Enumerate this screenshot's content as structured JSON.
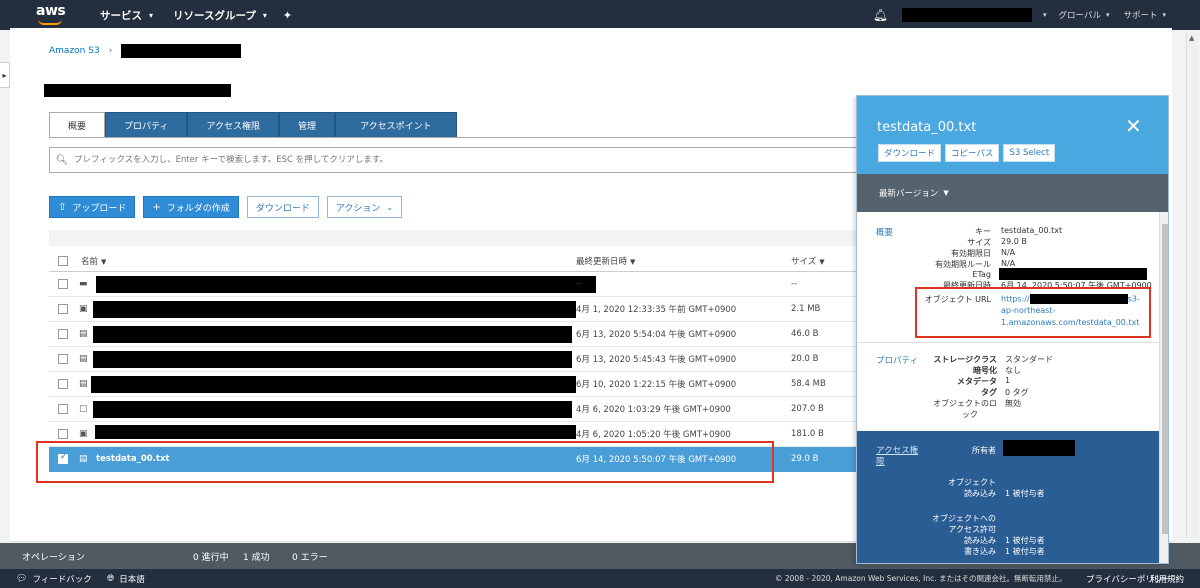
{
  "topnav": {
    "logo": "aws",
    "services": "サービス",
    "resource_groups": "リソースグループ",
    "global": "グローバル",
    "support": "サポート"
  },
  "breadcrumb": {
    "root": "Amazon S3"
  },
  "tabs": [
    {
      "label": "概要"
    },
    {
      "label": "プロパティ"
    },
    {
      "label": "アクセス権限"
    },
    {
      "label": "管理"
    },
    {
      "label": "アクセスポイント"
    }
  ],
  "search": {
    "placeholder": "プレフィックスを入力し、Enter キーで検索します。ESC を押してクリアします。"
  },
  "toolbar": {
    "upload": "アップロード",
    "create_folder": "フォルダの作成",
    "download": "ダウンロード",
    "actions": "アクション"
  },
  "table": {
    "headers": {
      "name": "名前",
      "modified": "最終更新日時",
      "size": "サイズ"
    },
    "rows": [
      {
        "date": "--",
        "size": "--"
      },
      {
        "date": "4月 1, 2020 12:33:35 午前 GMT+0900",
        "size": "2.1 MB"
      },
      {
        "date": "6月 13, 2020 5:54:04 午後 GMT+0900",
        "size": "46.0 B"
      },
      {
        "date": "6月 13, 2020 5:45:43 午後 GMT+0900",
        "size": "20.0 B"
      },
      {
        "date": "6月 10, 2020 1:22:15 午後 GMT+0900",
        "size": "58.4 MB"
      },
      {
        "date": "4月 6, 2020 1:03:29 午後 GMT+0900",
        "size": "207.0 B"
      },
      {
        "date": "4月 6, 2020 1:05:20 午後 GMT+0900",
        "size": "181.0 B"
      },
      {
        "name": "testdata_00.txt",
        "date": "6月 14, 2020 5:50:07 午後 GMT+0900",
        "size": "29.0 B"
      }
    ]
  },
  "ops": {
    "label": "オペレーション",
    "in_progress": "0 進行中",
    "success": "1 成功",
    "error": "0 エラー"
  },
  "footer": {
    "feedback": "フィードバック",
    "language": "日本語",
    "copyright": "© 2008 - 2020, Amazon Web Services, Inc. またはその関連会社。無断転用禁止。",
    "privacy": "プライバシーポリシー",
    "terms": "利用規約"
  },
  "panel": {
    "title": "testdata_00.txt",
    "btn_download": "ダウンロード",
    "btn_copy_path": "コピーパス",
    "btn_s3select": "S3 Select",
    "version": "最新バージョン",
    "overview": {
      "label": "概要",
      "key_label": "キー",
      "key_value": "testdata_00.txt",
      "size_label": "サイズ",
      "size_value": "29.0 B",
      "expiry_label": "有効期限日",
      "expiry_value": "N/A",
      "expiry_rule_label": "有効期限ルール",
      "expiry_rule_value": "N/A",
      "etag_label": "ETag",
      "modified_label": "最終更新日時",
      "modified_value": "6月 14, 2020 5:50:07 午後 GMT+0900",
      "url_label": "オブジェクト URL",
      "url_line1_prefix": "https://",
      "url_line1_suffix": "s3-",
      "url_line2": "ap-northeast-",
      "url_line3": "1.amazonaws.com/testdata_00.txt"
    },
    "properties": {
      "label": "プロパティ",
      "storage_class_label": "ストレージクラス",
      "storage_class_value": "スタンダード",
      "encryption_label": "暗号化",
      "encryption_value": "なし",
      "metadata_label": "メタデータ",
      "metadata_value": "1",
      "tag_label": "タグ",
      "tag_value": "0 タグ",
      "lock_label_1": "オブジェクトのロ",
      "lock_label_2": "ック",
      "lock_value": "無効"
    },
    "access": {
      "label_1": "アクセス権",
      "label_2": "限",
      "owner_label": "所有者",
      "object_label": "オブジェクト",
      "read_label": "読み込み",
      "read_value": "1 被付与者",
      "acl_label_1": "オブジェクトへの",
      "acl_label_2": "アクセス許可",
      "acl_read_label": "読み込み",
      "acl_read_value": "1 被付与者",
      "acl_write_label": "書き込み",
      "acl_write_value": "1 被付与者"
    }
  }
}
